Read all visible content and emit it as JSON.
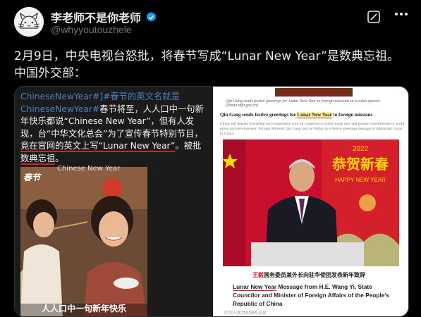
{
  "author": {
    "display_name": "李老师不是你老师",
    "handle": "@whyyoutouzhele",
    "verified_color": "#1d9bf0"
  },
  "tweet": {
    "line1": "2月9日，中央电视台怒批，将春节写成“Lunar New Year”是数典忘祖。",
    "line2": "中国外交部："
  },
  "left_image": {
    "caption_hash": "ChineseNewYear#]#春节的英文名就是ChineseNewYear#",
    "caption_rest": "春节将至，人人口中一句新年快乐都说“Chinese New Year”，但有人发现，台“中华文化总会”为了宣传春节特别节目，",
    "caption_ul1": "竟在官网的英文上写“Lunar New Year”",
    "caption_mid": "。被批",
    "caption_ul2": "数典忘祖",
    "caption_end": "。",
    "video_logo": "春节",
    "video_top_subtitle": "Chinese New Year",
    "video_subtitle": "人人口中一句新年快乐"
  },
  "right_image": {
    "photo_caption": "Qin Gang sends festive greetings for Lunar New Year to foreign missions in a video speech. (Photo/mfa.gov.cn)",
    "headline_pre": "Qin Gang sends festive greetings for ",
    "headline_hl": "Lunar New Year",
    "headline_post": " to foreign missions",
    "body": "China will deepen friendship and cooperation with all countries to jointly make new and greater contributions to world peace and development, Foreign Minister Qin Gang said on Friday in a festive greetings message to diplomatic corps in China.",
    "banner_year": "2022",
    "banner_cn": "恭贺新春",
    "banner_en": "HAPPY NEW YEAR",
    "wang_red": "王毅",
    "wang_rest": "国务委员兼外长向驻华使团发表新年致辞",
    "en_caption_ul": "Lunar New Year",
    "en_caption_rest": " Message from H.E. Wang Yi, State Councilor and Minister of Foreign Affairs of the People's Republic of China",
    "footer": "中华人民共和国外交部"
  }
}
